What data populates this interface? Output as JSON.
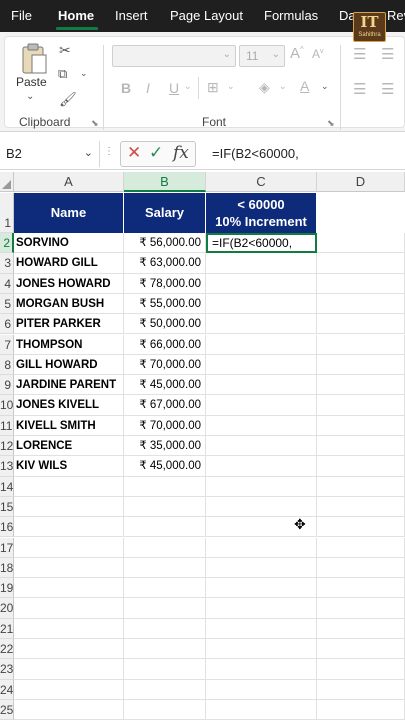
{
  "menu": {
    "tabs": [
      "File",
      "Home",
      "Insert",
      "Page Layout",
      "Formulas",
      "Da",
      "Rev"
    ],
    "active": "Home"
  },
  "logo": {
    "text": "IT",
    "sub": "Sahithra"
  },
  "ribbon": {
    "clipboard": {
      "paste_label": "Paste",
      "group_label": "Clipboard"
    },
    "font": {
      "size_value": "11",
      "group_label": "Font"
    },
    "icons": [
      "cut-icon",
      "copy-icon",
      "format-painter-icon",
      "bold-icon",
      "italic-icon",
      "underline-icon",
      "borders-icon",
      "fill-color-icon",
      "font-color-icon",
      "align-top-icon",
      "align-left-icon"
    ]
  },
  "formula_bar": {
    "name_box": "B2",
    "formula": "=IF(B2<60000,"
  },
  "columns": [
    "A",
    "B",
    "C",
    "D"
  ],
  "rows": [
    "1",
    "2",
    "3",
    "4",
    "5",
    "6",
    "7",
    "8",
    "9",
    "10",
    "11",
    "12",
    "13",
    "14",
    "15",
    "16",
    "17",
    "18",
    "19",
    "20",
    "21",
    "22",
    "23",
    "24",
    "25"
  ],
  "table": {
    "headers": {
      "name": "Name",
      "salary": "Salary",
      "increment_line1": "< 60000",
      "increment_line2": "10% Increment"
    },
    "records": [
      {
        "name": "SORVINO",
        "salary": "₹ 56,000.00"
      },
      {
        "name": "HOWARD GILL",
        "salary": "₹ 63,000.00"
      },
      {
        "name": "JONES HOWARD",
        "salary": "₹ 78,000.00"
      },
      {
        "name": "MORGAN BUSH",
        "salary": "₹ 55,000.00"
      },
      {
        "name": "PITER PARKER",
        "salary": "₹ 50,000.00"
      },
      {
        "name": "THOMPSON",
        "salary": "₹ 66,000.00"
      },
      {
        "name": "GILL HOWARD",
        "salary": "₹ 70,000.00"
      },
      {
        "name": "JARDINE PARENT",
        "salary": "₹ 45,000.00"
      },
      {
        "name": "JONES KIVELL",
        "salary": "₹ 67,000.00"
      },
      {
        "name": "KIVELL SMITH",
        "salary": "₹ 70,000.00"
      },
      {
        "name": "LORENCE",
        "salary": "₹ 35,000.00"
      },
      {
        "name": "KIV WILS",
        "salary": "₹ 45,000.00"
      }
    ],
    "editing_cell": "=IF(B2<60000,"
  },
  "colors": {
    "accent": "#107c41",
    "header_fill": "#0d2b7a",
    "menubar": "#1f1f1f"
  }
}
